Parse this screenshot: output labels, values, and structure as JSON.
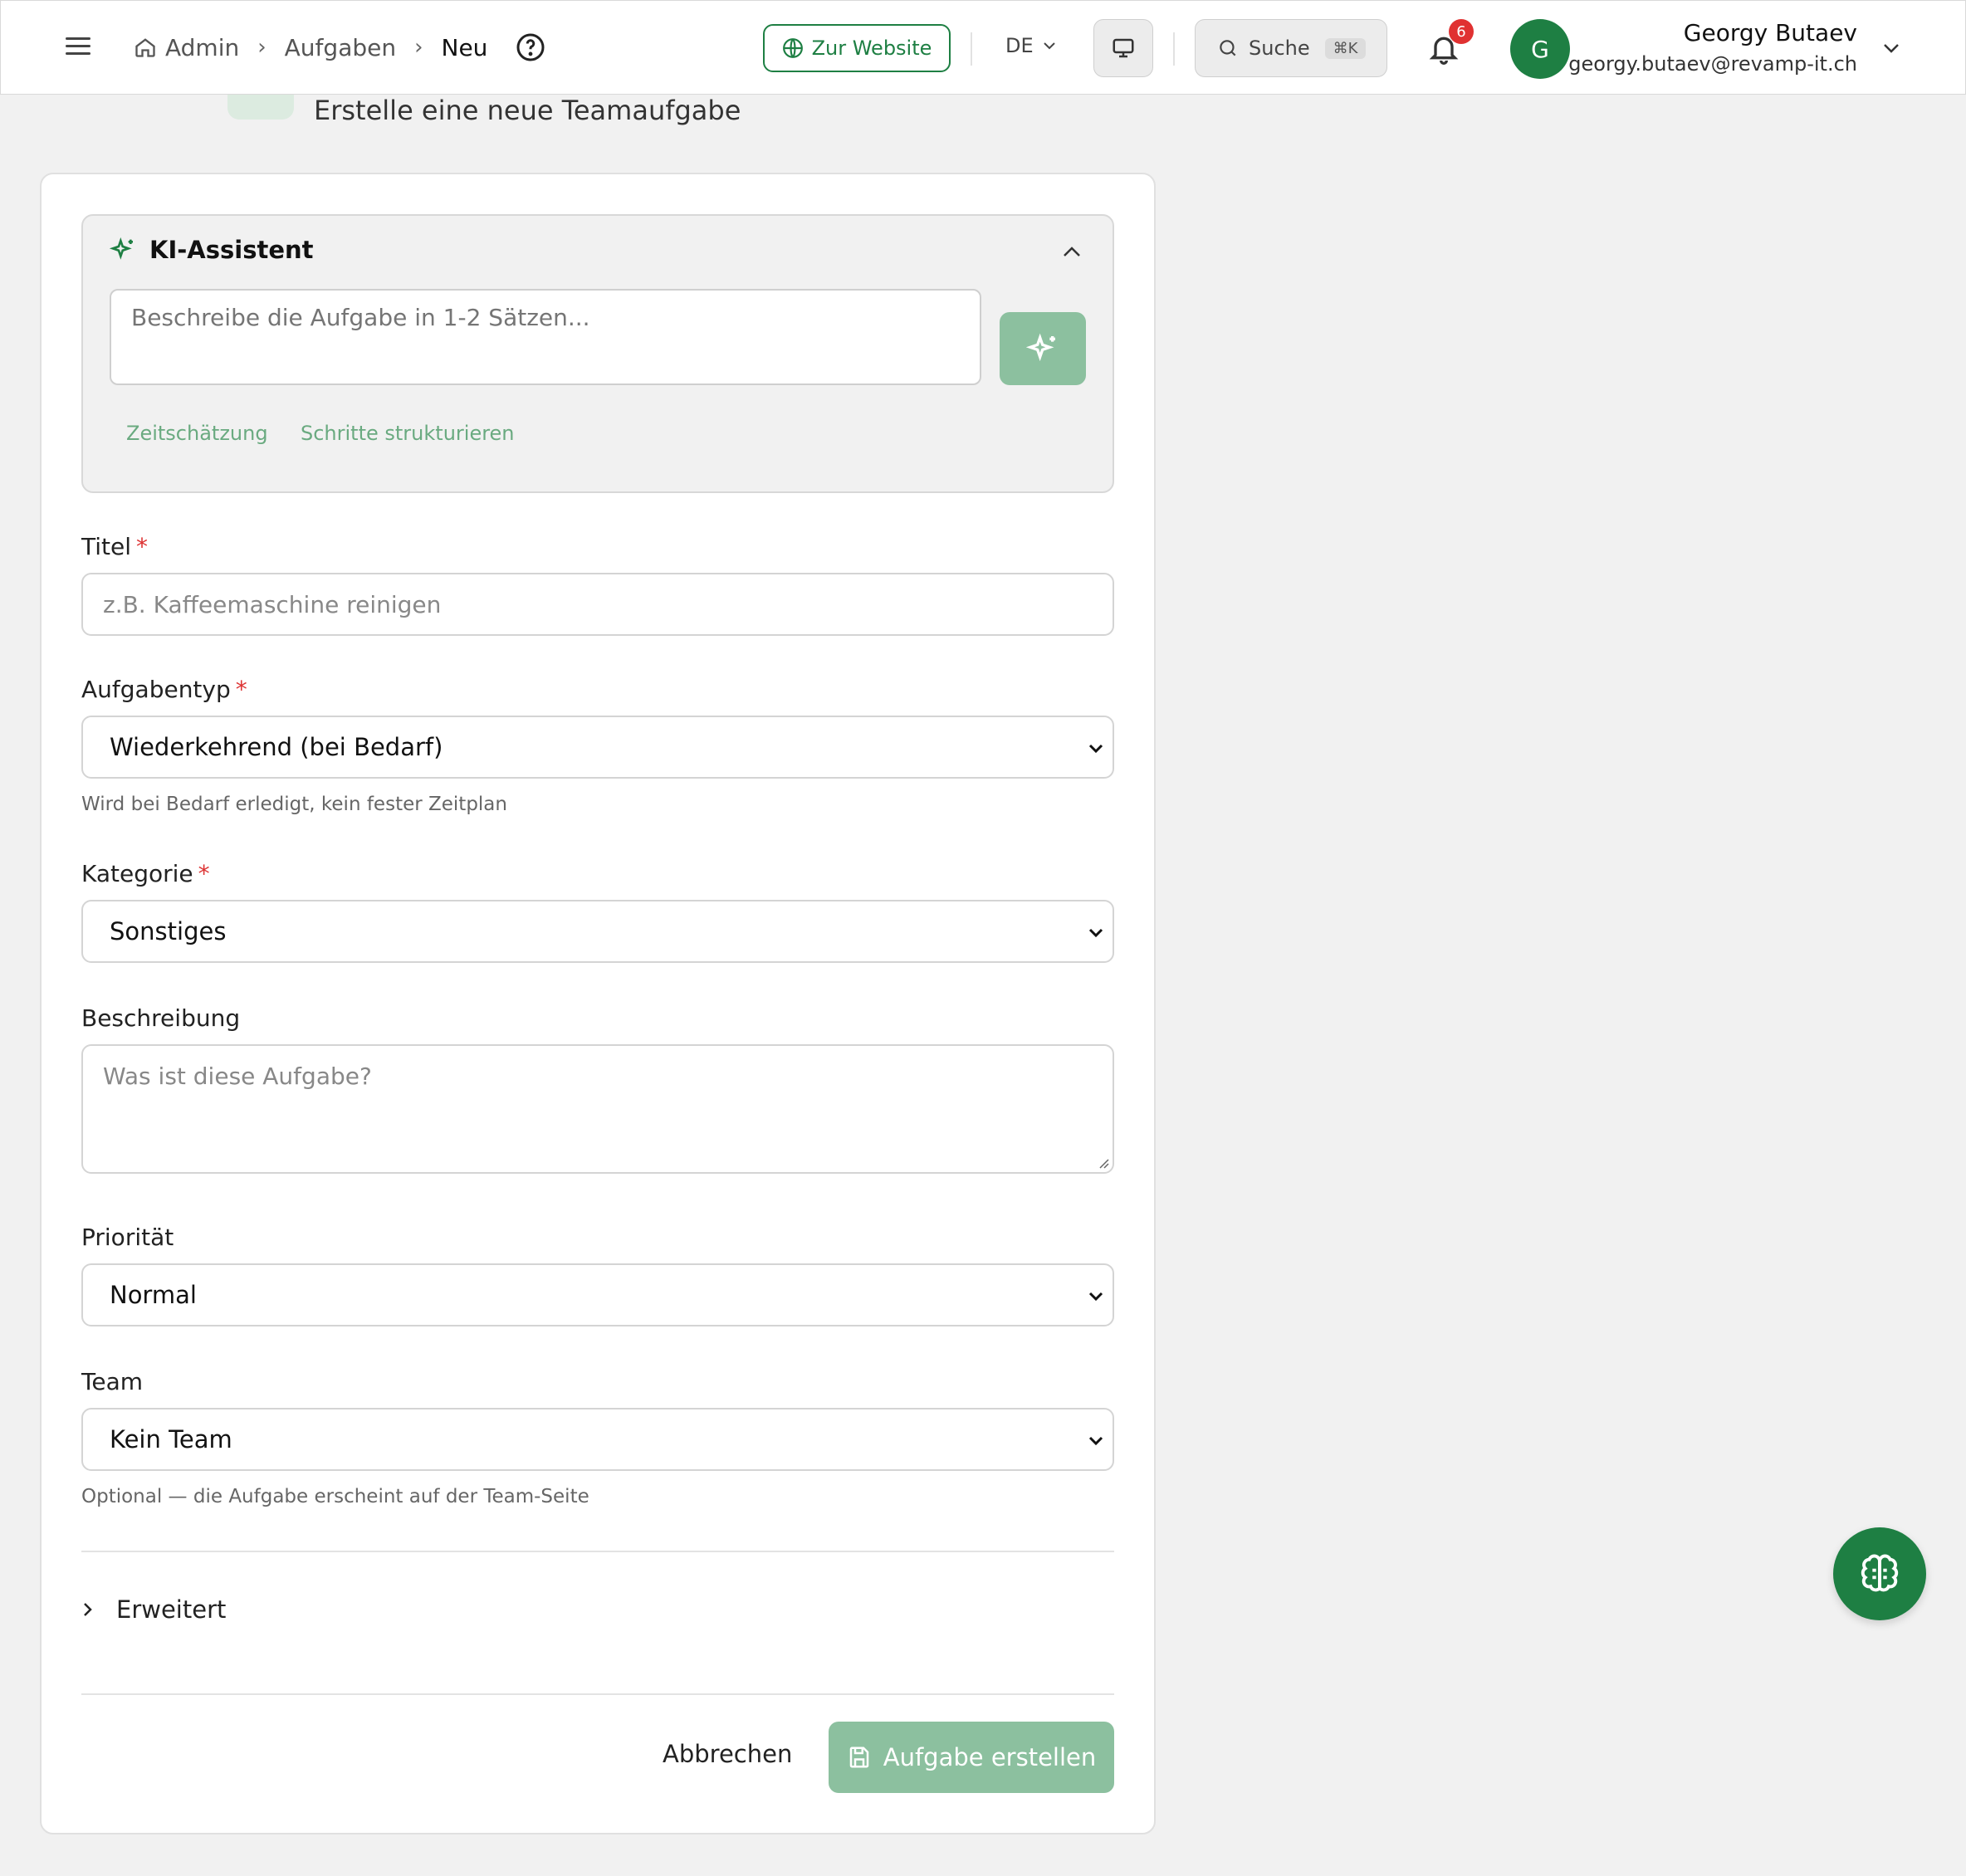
{
  "topbar": {
    "breadcrumbs": [
      "Admin",
      "Aufgaben",
      "Neu"
    ],
    "website_label": "Zur Website",
    "language": "DE",
    "search_label": "Suche",
    "search_shortcut": "⌘K",
    "notification_count": "6",
    "avatar_initial": "G",
    "user_name": "Georgy Butaev",
    "user_email": "georgy.butaev@revamp-it.ch"
  },
  "header": {
    "subtitle": "Erstelle eine neue Teamaufgabe"
  },
  "ai_assistant": {
    "title": "KI-Assistent",
    "input_placeholder": "Beschreibe die Aufgabe in 1-2 Sätzen...",
    "chips": [
      "Zeitschätzung",
      "Schritte strukturieren"
    ]
  },
  "form": {
    "title_label": "Titel",
    "title_placeholder": "z.B. Kaffeemaschine reinigen",
    "type_label": "Aufgabentyp",
    "type_value": "Wiederkehrend (bei Bedarf)",
    "type_hint": "Wird bei Bedarf erledigt, kein fester Zeitplan",
    "category_label": "Kategorie",
    "category_value": "Sonstiges",
    "description_label": "Beschreibung",
    "description_placeholder": "Was ist diese Aufgabe?",
    "priority_label": "Priorität",
    "priority_value": "Normal",
    "team_label": "Team",
    "team_value": "Kein Team",
    "team_hint": "Optional — die Aufgabe erscheint auf der Team-Seite",
    "advanced_label": "Erweitert",
    "required_mark": "*"
  },
  "actions": {
    "cancel_label": "Abbrechen",
    "submit_label": "Aufgabe erstellen"
  },
  "colors": {
    "brand": "#1e7f43",
    "brand_light": "#8cc09f",
    "required": "#dd3333",
    "badge": "#e03131"
  }
}
